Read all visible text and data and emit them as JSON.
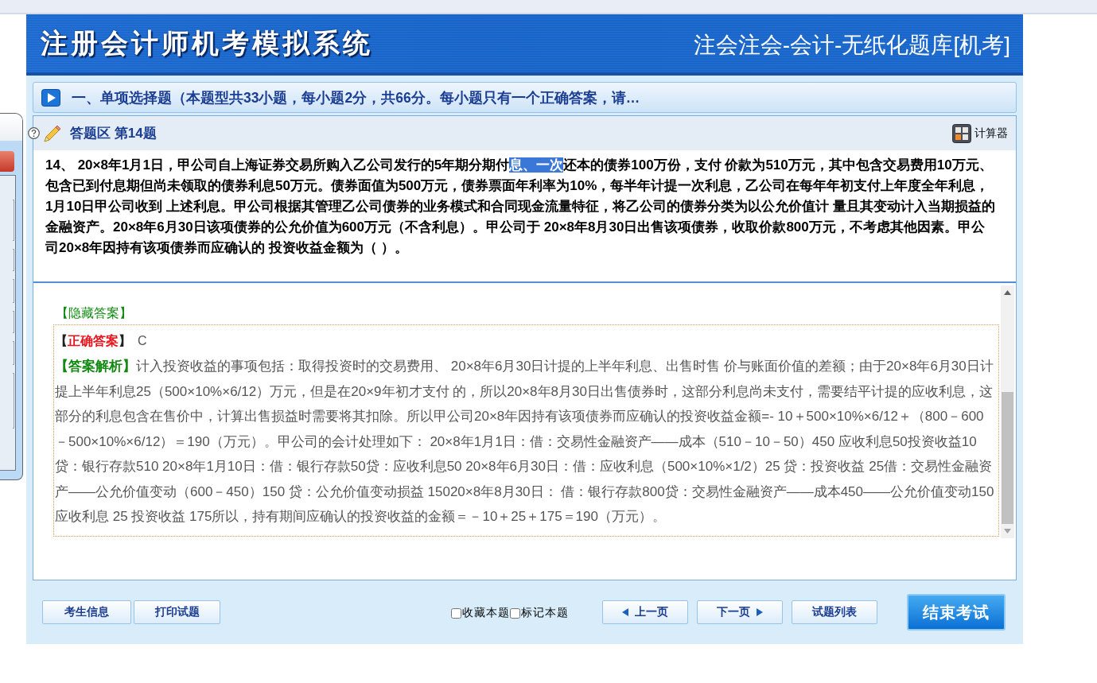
{
  "header": {
    "title": "注册会计师机考模拟系统",
    "subtitle": "注会注会-会计-无纸化题库[机考]"
  },
  "section": {
    "title": "一、单项选择题（本题型共33小题，每小题2分，共66分。每小题只有一个正确答案，请…"
  },
  "answer_area": {
    "title": "答题区 第14题",
    "calculator": "计算器"
  },
  "question": {
    "segments": [
      {
        "text": "14、 20×8年1月1日，甲公司自上海证券交易所购入乙公司发行的5年期分期付",
        "highlighted": false
      },
      {
        "text": "息、一次",
        "highlighted": true
      },
      {
        "text": "还本的债券100万份，支付 价款为510万元，其中包含交易费用10万元、包含已到付息期但尚未领取的债券利息50万元。债券面值为500万元，债券票面年利率为10%，每半年计提一次利息，乙公司在每年年初支付上年度全年利息，1月10日甲公司收到 上述利息。甲公司根据其管理乙公司债券的业务模式和合同现金流量特征，将乙公司的债券分类为以公允价值计 量且其变动计入当期损益的金融资产。20×8年6月30日该项债券的公允价值为600万元（不含利息）。甲公司于 20×8年8月30日出售该项债券，收取价款800万元，不考虑其他因素。甲公司20×8年因持有该项债券而应确认的 投资收益金额为（ ）。",
        "highlighted": false
      }
    ]
  },
  "answer": {
    "toggle": "【隐藏答案】",
    "expanded": true,
    "correct_label": "【**正确答案**】",
    "correct_value": "C",
    "analysis": "**【答案解析】**计入投资收益的事项包括：取得投资时的交易费用、 20×8年6月30日计提的上半年利息、出售时售 价与账面价值的差额；由于20×8年6月30日计提上半年利息25（500×10%×6/12）万元，但是在20×9年初才支付 的，所以20×8年8月30日出售债券时，这部分利息尚未支付，需要结平计提的应收利息，这部分的利息包含在售价中，计算出售损益时需要将其扣除。所以甲公司20×8年因持有该项债券而应确认的投资收益金额=- 10＋500×10%×6/12＋（800－600－500×10%×6/12）＝190（万元）。甲公司的会计处理如下： 20×8年1月1日：借：交易性金融资产——成本（510－10－50）450 应收利息50投资收益10贷：银行存款510 20×8年1月10日：借：银行存款50贷：应收利息50 20×8年6月30日：借：应收利息（500×10%×1/2）25 贷：投资收益 25借：交易性金融资产——公允价值变动（600－450）150 贷：公允价值变动损益 15020×8年8月30日： 借：银行存款800贷：交易性金融资产——成本450——公允价值变动150应收利息 25 投资收益 175所以，持有期间应确认的投资收益的金额＝－10＋25＋175＝190（万元）。"
  },
  "footer": {
    "left_buttons": [
      "考生信息",
      "打印试题"
    ],
    "checkboxes": [
      {
        "label": "收藏本题",
        "checked": false
      },
      {
        "label": "标记本题",
        "checked": false
      }
    ],
    "nav_buttons": [
      {
        "label": "上一页",
        "kind": "prev"
      },
      {
        "label": "下一页",
        "kind": "next"
      },
      {
        "label": "试题列表",
        "kind": "list"
      }
    ],
    "finish": "结束考试"
  }
}
